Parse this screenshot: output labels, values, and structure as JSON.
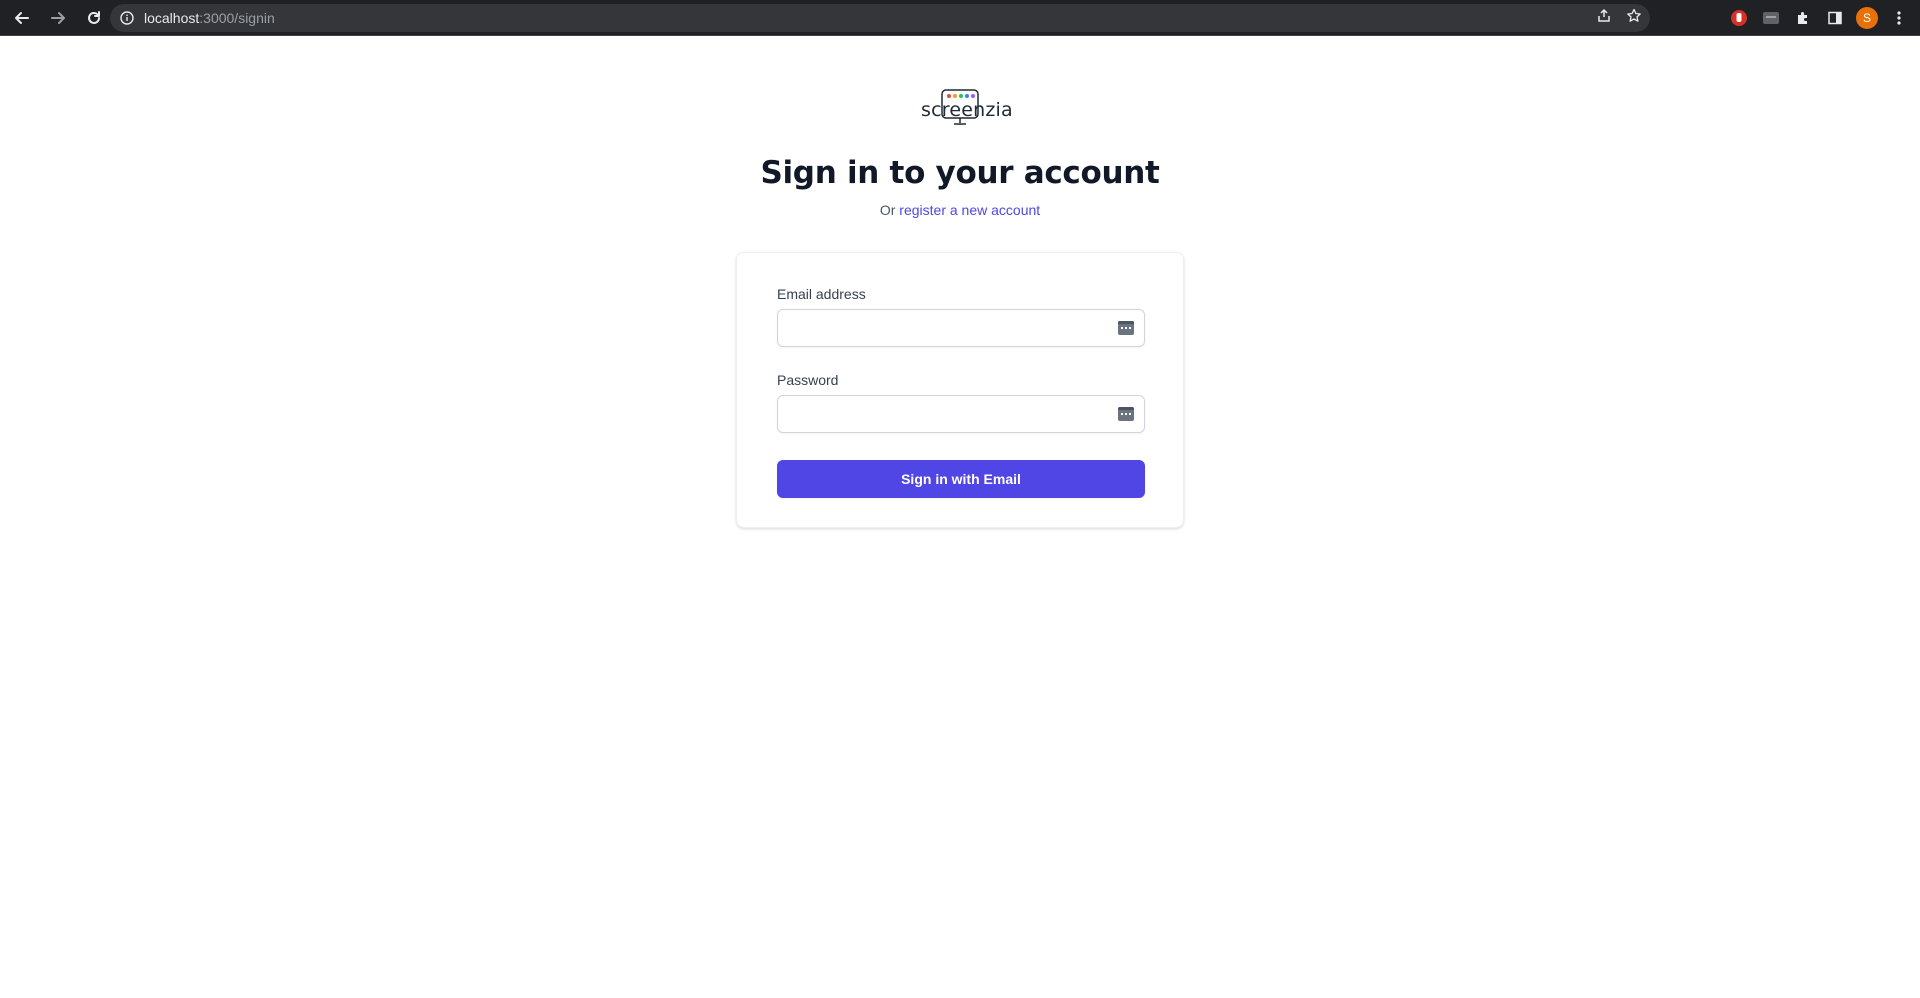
{
  "browser": {
    "url_host": "localhost",
    "url_path": ":3000/signin",
    "profile_initial": "S"
  },
  "logo": {
    "text": "screenzia",
    "dot_colors": [
      "#ef4444",
      "#f59e0b",
      "#22c55e",
      "#3b82f6",
      "#a855f7"
    ]
  },
  "heading": {
    "title": "Sign in to your account",
    "subtitle_prefix": "Or",
    "register_link": "register a new account"
  },
  "form": {
    "email_label": "Email address",
    "email_value": "",
    "password_label": "Password",
    "password_value": "",
    "submit_label": "Sign in with Email"
  },
  "colors": {
    "accent": "#4f46e5",
    "title": "#111827"
  }
}
